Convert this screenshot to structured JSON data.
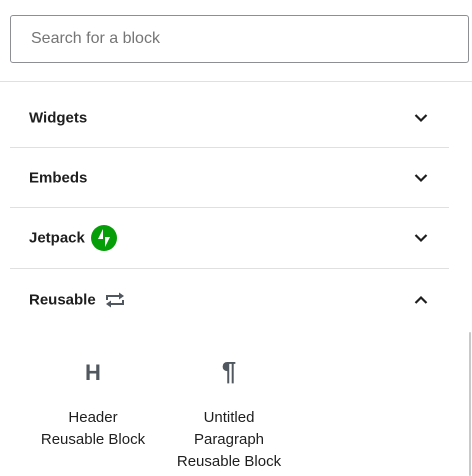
{
  "search": {
    "placeholder": "Search for a block"
  },
  "panels": [
    {
      "title": "Widgets",
      "expanded": false
    },
    {
      "title": "Embeds",
      "expanded": false
    },
    {
      "title": "Jetpack",
      "expanded": false,
      "icon": "jetpack-icon",
      "icon_color": "#069e08"
    },
    {
      "title": "Reusable",
      "expanded": true,
      "icon": "reusable-icon"
    }
  ],
  "reusable_blocks": [
    {
      "icon": "H",
      "icon_name": "heading-icon",
      "label": "Header\nReusable Block"
    },
    {
      "icon": "¶",
      "icon_name": "paragraph-icon",
      "label": "Untitled\nParagraph\nReusable Block"
    }
  ],
  "colors": {
    "text": "#1e1e1e",
    "muted": "#757575",
    "divider": "#e0e0e0",
    "jetpack": "#069e08"
  }
}
